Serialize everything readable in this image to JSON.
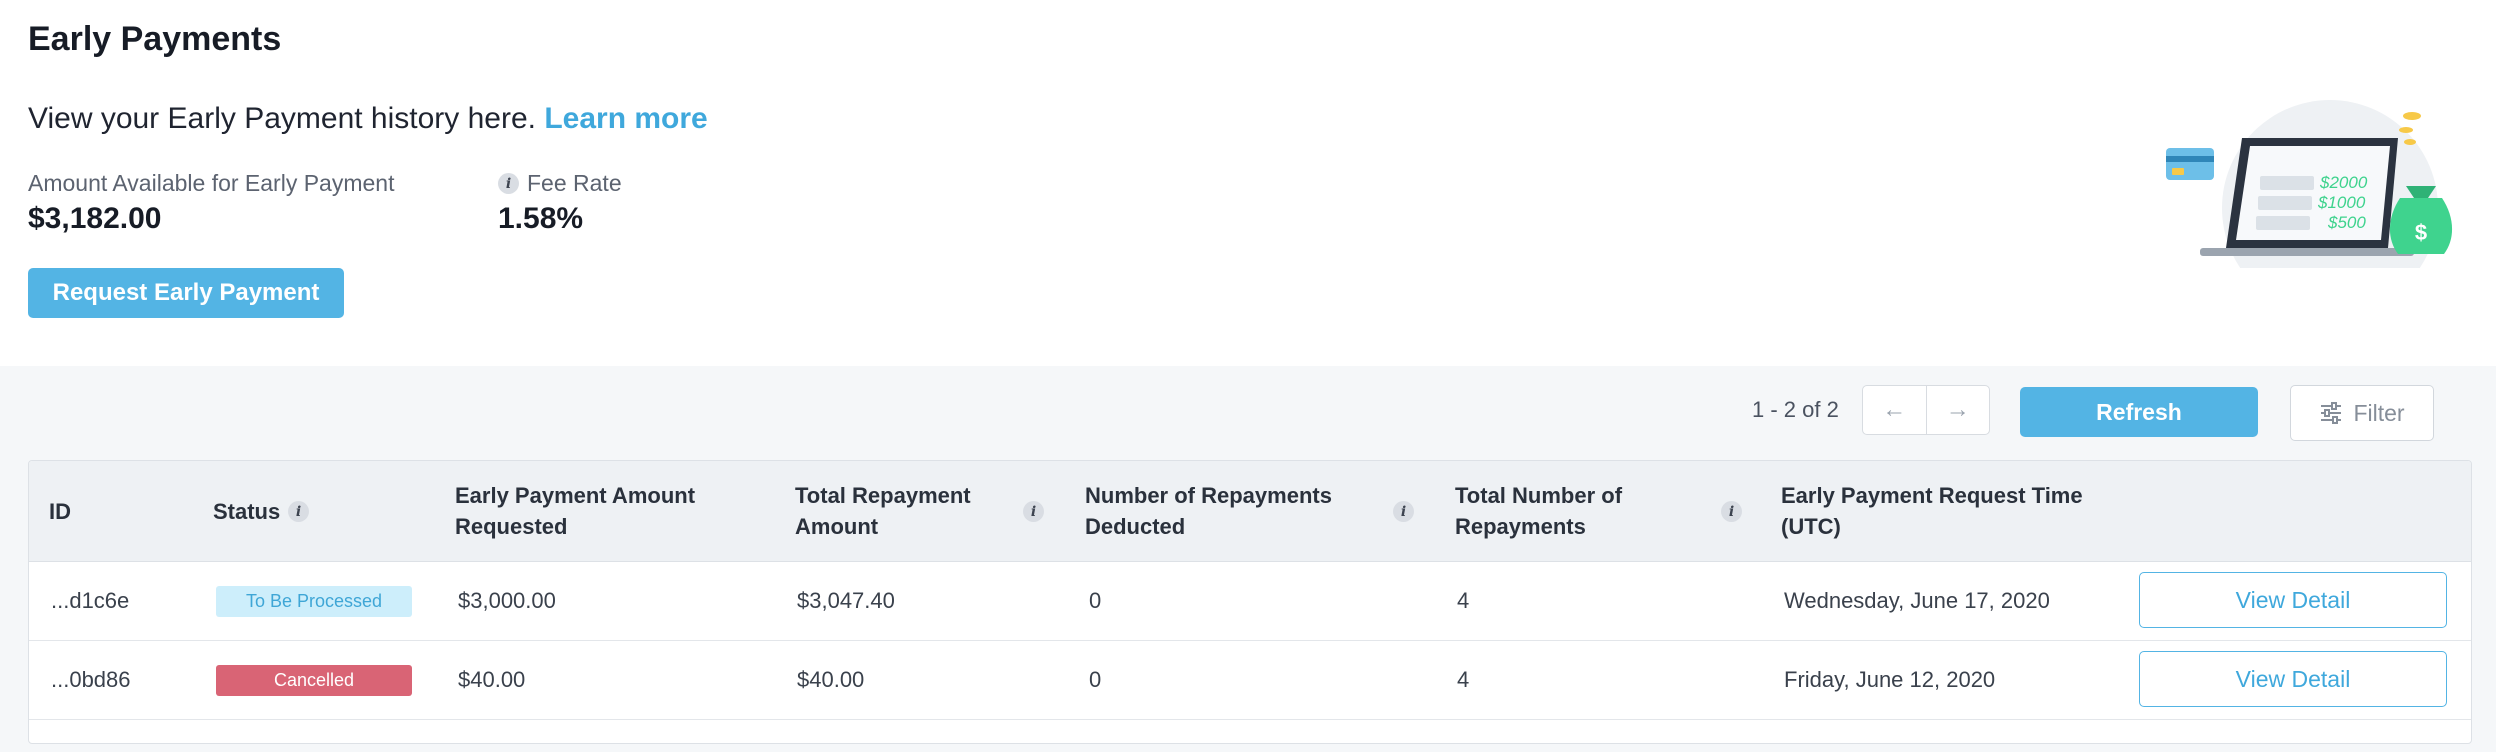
{
  "header": {
    "title": "Early Payments",
    "intro_text": "View your Early Payment history here. ",
    "learn_more": "Learn more"
  },
  "metrics": {
    "available_label": "Amount Available for Early Payment",
    "available_value": "$3,182.00",
    "fee_label": "Fee Rate",
    "fee_value": "1.58%",
    "info_glyph": "i"
  },
  "actions": {
    "request_label": "Request Early Payment"
  },
  "illustration": {
    "amounts": [
      "$2000",
      "$1000",
      "$500"
    ],
    "bag_symbol": "$",
    "colors": {
      "circle": "#eef1f4",
      "accent": "#3fd38e",
      "card": "#53b4e4",
      "coin": "#f7c948"
    }
  },
  "toolbar": {
    "pager_text": "1 - 2 of 2",
    "prev_icon": "←",
    "next_icon": "→",
    "refresh_label": "Refresh",
    "filter_label": "Filter"
  },
  "table": {
    "columns": [
      {
        "label": "ID",
        "info": false
      },
      {
        "label": "Status",
        "info": true
      },
      {
        "label": "Early Payment Amount Requested",
        "info": false
      },
      {
        "label": "Total Repayment Amount",
        "info": true
      },
      {
        "label": "Number of Repayments Deducted",
        "info": true
      },
      {
        "label": "Total Number of Repayments",
        "info": true
      },
      {
        "label": "Early Payment Request Time (UTC)",
        "info": false
      }
    ],
    "rows": [
      {
        "id": "...d1c6e",
        "status": "To Be Processed",
        "status_type": "processing",
        "amount": "$3,000.00",
        "total": "$3,047.40",
        "deducted": "0",
        "count": "4",
        "time": "Wednesday, June 17, 2020",
        "action": "View Detail"
      },
      {
        "id": "...0bd86",
        "status": "Cancelled",
        "status_type": "cancelled",
        "amount": "$40.00",
        "total": "$40.00",
        "deducted": "0",
        "count": "4",
        "time": "Friday, June 12, 2020",
        "action": "View Detail"
      }
    ]
  },
  "colors": {
    "accent": "#53b4e4",
    "link": "#3fa8dc",
    "status_processing_bg": "#cdeefb",
    "status_cancelled_bg": "#d96475"
  }
}
